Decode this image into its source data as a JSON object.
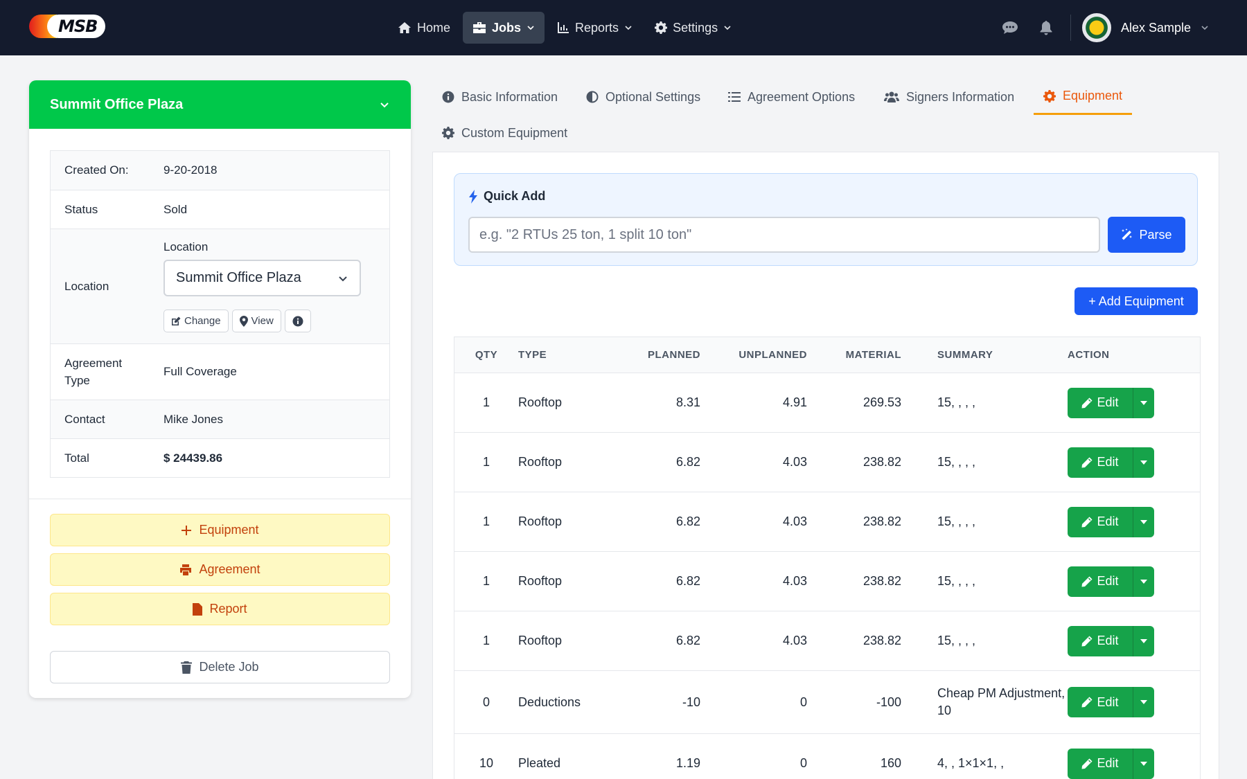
{
  "brand": {
    "logo_text": "MSB"
  },
  "nav": {
    "items": [
      {
        "label": "Home",
        "icon": "home-icon"
      },
      {
        "label": "Jobs",
        "icon": "briefcase-icon"
      },
      {
        "label": "Reports",
        "icon": "chart-icon"
      },
      {
        "label": "Settings",
        "icon": "gear-icon"
      }
    ],
    "active": "Jobs"
  },
  "user": {
    "name": "Alex Sample"
  },
  "job": {
    "title": "Summit Office Plaza",
    "fields": {
      "created_label": "Created On:",
      "created_value": "9-20-2018",
      "status_label": "Status",
      "status_value": "Sold",
      "location_label": "Location",
      "location_inner_label": "Location",
      "location_selected": "Summit Office Plaza",
      "change_label": "Change",
      "view_label": "View",
      "agreement_type_label": "Agreement Type",
      "agreement_type_value": "Full Coverage",
      "contact_label": "Contact",
      "contact_value": "Mike Jones",
      "total_label": "Total",
      "total_value": "$ 24439.86"
    },
    "actions": {
      "equipment": "Equipment",
      "agreement": "Agreement",
      "report": "Report",
      "delete": "Delete Job"
    }
  },
  "tabs": [
    {
      "label": "Basic Information",
      "icon": "info-circle-icon"
    },
    {
      "label": "Optional Settings",
      "icon": "half-circle-icon"
    },
    {
      "label": "Agreement Options",
      "icon": "list-icon"
    },
    {
      "label": "Signers Information",
      "icon": "users-icon"
    },
    {
      "label": "Equipment",
      "icon": "gear-icon",
      "active": true
    },
    {
      "label": "Custom Equipment",
      "icon": "gear-icon"
    }
  ],
  "quick_add": {
    "title": "Quick Add",
    "placeholder": "e.g. \"2 RTUs 25 ton, 1 split 10 ton\"",
    "value": "",
    "parse_label": "Parse"
  },
  "add_equipment_label": "+ Add Equipment",
  "table": {
    "headers": [
      "QTY",
      "TYPE",
      "PLANNED",
      "UNPLANNED",
      "MATERIAL",
      "SUMMARY",
      "ACTION"
    ],
    "edit_label": "Edit",
    "rows": [
      {
        "qty": "1",
        "type": "Rooftop",
        "planned": "8.31",
        "unplanned": "4.91",
        "material": "269.53",
        "summary": "15, , , ,"
      },
      {
        "qty": "1",
        "type": "Rooftop",
        "planned": "6.82",
        "unplanned": "4.03",
        "material": "238.82",
        "summary": "15, , , ,"
      },
      {
        "qty": "1",
        "type": "Rooftop",
        "planned": "6.82",
        "unplanned": "4.03",
        "material": "238.82",
        "summary": "15, , , ,"
      },
      {
        "qty": "1",
        "type": "Rooftop",
        "planned": "6.82",
        "unplanned": "4.03",
        "material": "238.82",
        "summary": "15, , , ,"
      },
      {
        "qty": "1",
        "type": "Rooftop",
        "planned": "6.82",
        "unplanned": "4.03",
        "material": "238.82",
        "summary": "15, , , ,"
      },
      {
        "qty": "0",
        "type": "Deductions",
        "planned": "-10",
        "unplanned": "0",
        "material": "-100",
        "summary": "Cheap PM Adjustment, 10"
      },
      {
        "qty": "10",
        "type": "Pleated",
        "planned": "1.19",
        "unplanned": "0",
        "material": "160",
        "summary": "4, , 1×1×1, ,"
      }
    ]
  },
  "colors": {
    "topbar": "#141b2d",
    "header_green": "#00c84a",
    "primary_blue": "#1d5bf5",
    "edit_green": "#16a34a",
    "accent_orange": "#ea580c"
  }
}
